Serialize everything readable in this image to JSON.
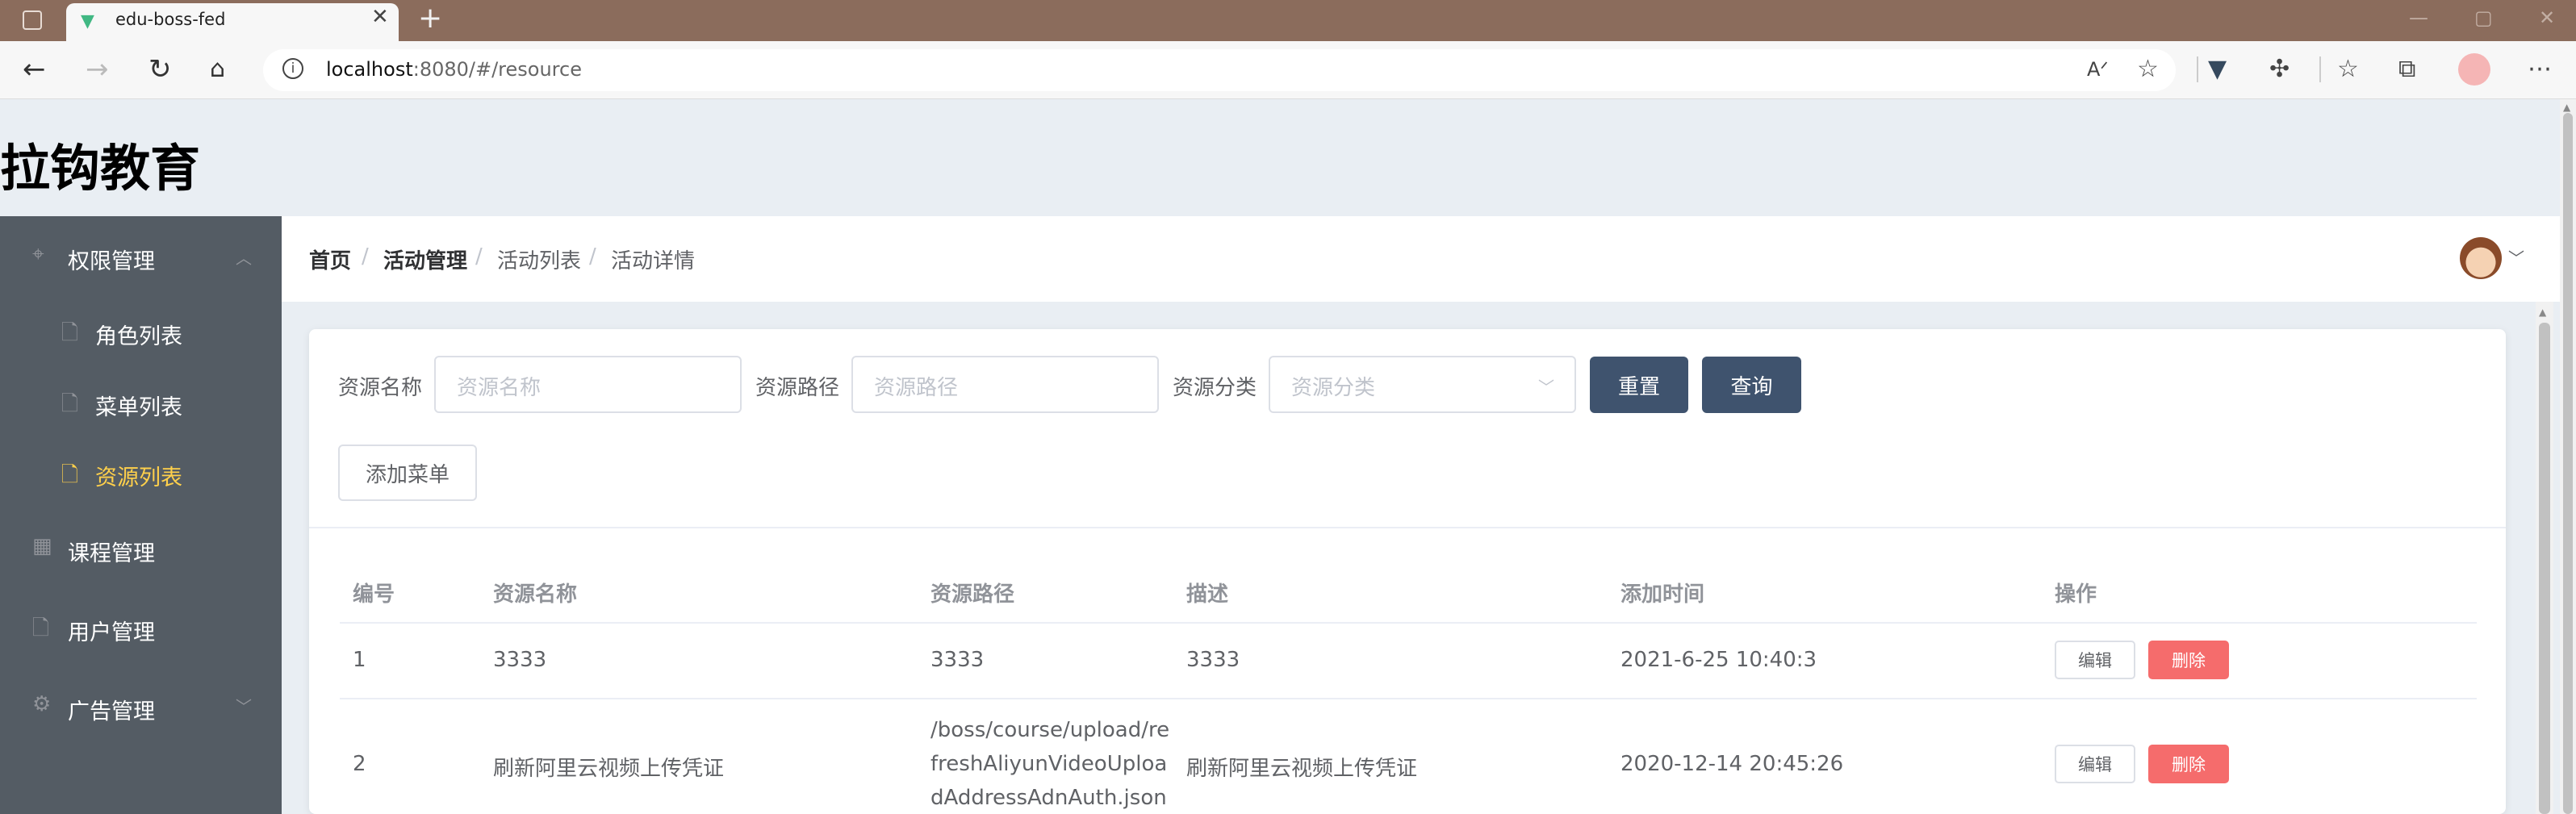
{
  "browser": {
    "tab_title": "edu-boss-fed",
    "tab_close": "✕",
    "new_tab": "+",
    "url_host": "localhost",
    "url_rest": ":8080/#/resource",
    "icons": [
      "back-icon",
      "forward-icon",
      "refresh-icon",
      "home-icon",
      "info-icon",
      "read-aloud-icon",
      "favorite-add-icon",
      "vue-devtools-icon",
      "extensions-icon",
      "favorites-icon",
      "collections-icon",
      "profile-icon",
      "more-icon"
    ]
  },
  "app": {
    "logo": "拉钩教育"
  },
  "sidebar": {
    "items": [
      {
        "label": "权限管理",
        "icon": "location-icon",
        "expanded": true
      },
      {
        "label": "角色列表",
        "icon": "document-icon"
      },
      {
        "label": "菜单列表",
        "icon": "document-icon"
      },
      {
        "label": "资源列表",
        "icon": "document-icon",
        "active": true
      },
      {
        "label": "课程管理",
        "icon": "grid-icon"
      },
      {
        "label": "用户管理",
        "icon": "document-icon"
      },
      {
        "label": "广告管理",
        "icon": "gear-icon",
        "expanded": false
      }
    ],
    "active_color": "#ffd04b"
  },
  "breadcrumb": {
    "items": [
      "首页",
      "活动管理",
      "活动列表",
      "活动详情"
    ],
    "separator": "/"
  },
  "filters": {
    "name_label": "资源名称",
    "name_placeholder": "资源名称",
    "path_label": "资源路径",
    "path_placeholder": "资源路径",
    "category_label": "资源分类",
    "category_placeholder": "资源分类",
    "reset_button": "重置",
    "query_button": "查询",
    "add_button": "添加菜单"
  },
  "table": {
    "headers": [
      "编号",
      "资源名称",
      "资源路径",
      "描述",
      "添加时间",
      "操作"
    ],
    "rows": [
      {
        "id": "1",
        "name": "3333",
        "path_lines": [
          "3333"
        ],
        "desc": "3333",
        "time": "2021-6-25 10:40:3"
      },
      {
        "id": "2",
        "name": "刷新阿里云视频上传凭证",
        "path_lines": [
          "/boss/course/upload/re",
          "freshAliyunVideoUploa",
          "dAddressAdnAuth.json"
        ],
        "desc": "刷新阿里云视频上传凭证",
        "time": "2020-12-14 20:45:26"
      }
    ],
    "edit_label": "编辑",
    "delete_label": "删除"
  },
  "colors": {
    "sidebar_bg": "#545c64",
    "primary_button": "#3f536e",
    "danger": "#f56c6c"
  }
}
